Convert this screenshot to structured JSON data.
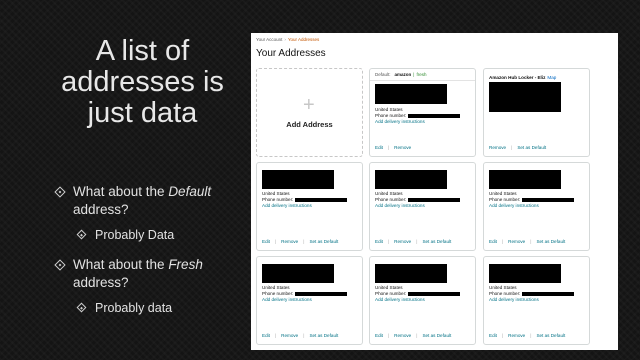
{
  "slide": {
    "title_lines": [
      "A list of",
      "addresses is",
      "just data"
    ],
    "bullets": [
      {
        "pre": "What about the ",
        "em": "Default",
        "post": " address?",
        "sub": "Probably Data"
      },
      {
        "pre": "What about the ",
        "em": "Fresh",
        "post": " address?",
        "sub": "Probably data"
      }
    ]
  },
  "screenshot": {
    "breadcrumb": {
      "parent": "Your Account",
      "separator": "›",
      "current": "Your Addresses"
    },
    "heading": "Your Addresses",
    "add_card": {
      "icon": "plus-icon",
      "plus": "+",
      "label": "Add Address"
    },
    "default_card": {
      "default_label": "Default:",
      "amazon_label": "amazon",
      "fresh_separator": "|",
      "fresh_label": "fresh",
      "country": "United States",
      "phone_label": "Phone number:",
      "delivery_link": "Add delivery instructions",
      "edit": "Edit",
      "remove": "Remove"
    },
    "locker_card": {
      "name": "Amazon Hub Locker - Eliz",
      "map": "Map",
      "remove": "Remove",
      "set_default": "Set as Default"
    },
    "address_card": {
      "country": "United States",
      "phone_label": "Phone number:",
      "delivery_link": "Add delivery instructions",
      "edit": "Edit",
      "remove": "Remove",
      "set_default": "Set as Default"
    }
  }
}
